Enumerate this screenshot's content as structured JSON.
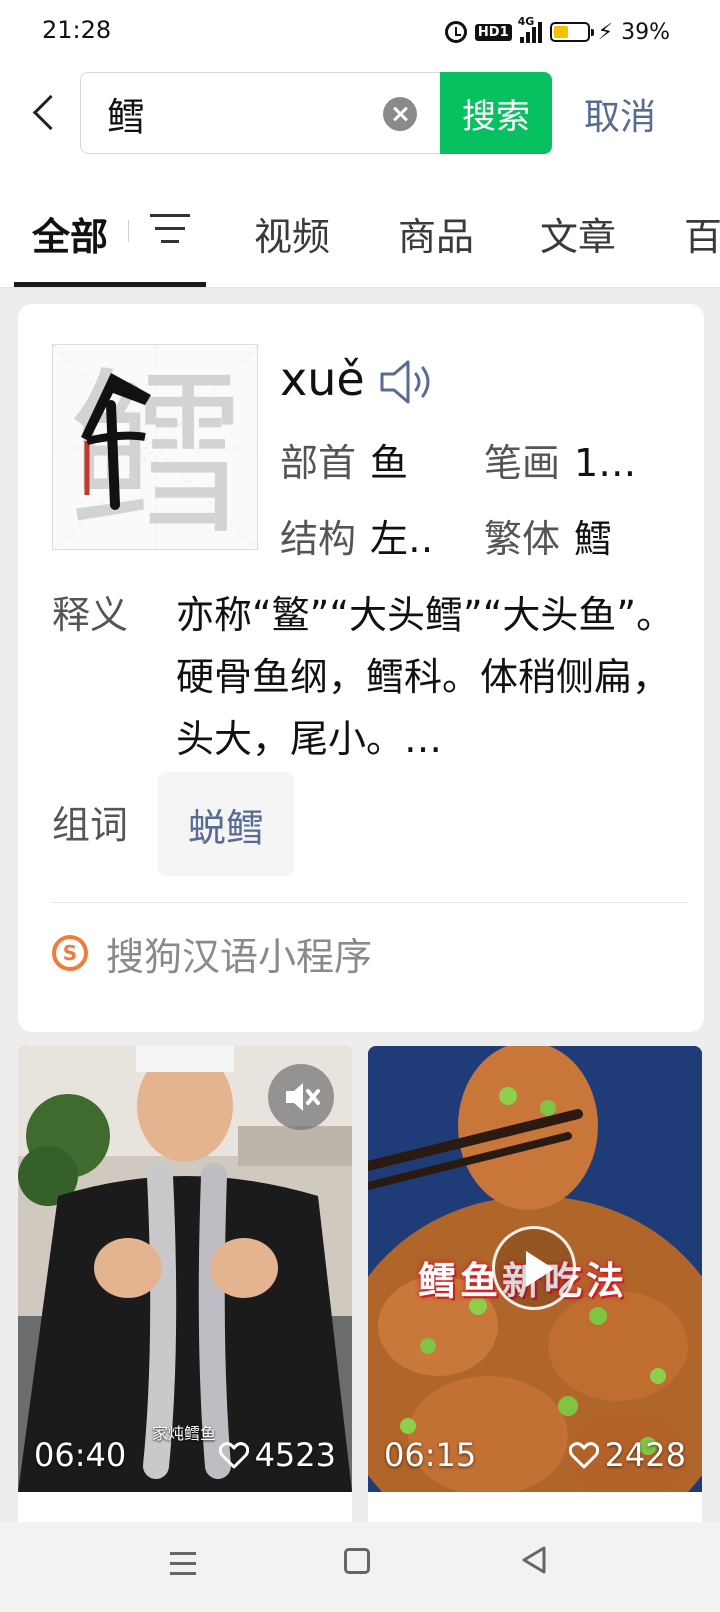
{
  "status_bar": {
    "time": "21:28",
    "hd_label": "HD1",
    "network": "4G",
    "battery_percent": "39%"
  },
  "search": {
    "query": "鳕",
    "search_label": "搜索",
    "cancel_label": "取消"
  },
  "tabs": [
    {
      "label": "全部",
      "active": true
    },
    {
      "label": "视频",
      "active": false
    },
    {
      "label": "商品",
      "active": false
    },
    {
      "label": "文章",
      "active": false
    },
    {
      "label": "百",
      "active": false
    }
  ],
  "dictionary": {
    "character": "鳕",
    "pinyin": "xuě",
    "radical_label": "部首",
    "radical_value": "鱼",
    "strokes_label": "笔画",
    "strokes_value": "1…",
    "structure_label": "结构",
    "structure_value": "左‥",
    "traditional_label": "繁体",
    "traditional_value": "鱈",
    "definition_label": "释义",
    "definition_text": "亦称“鳘”“大头鳕”“大头鱼”。硬骨鱼纲，鳕科。体稍侧扁，头大，尾小。…",
    "words_label": "组词",
    "words": [
      "蜕鳕"
    ],
    "source": "搜狗汉语小程序",
    "source_icon": "sogou-s"
  },
  "videos": [
    {
      "duration": "06:40",
      "likes": "4523",
      "caption": "家炖鳕鱼",
      "muted": true
    },
    {
      "duration": "06:15",
      "likes": "2428",
      "overlay_title": "鳕鱼新吃法",
      "playable": true
    }
  ],
  "colors": {
    "accent_green": "#07c160",
    "link_blue": "#576b95",
    "source_orange": "#f47a3a"
  }
}
